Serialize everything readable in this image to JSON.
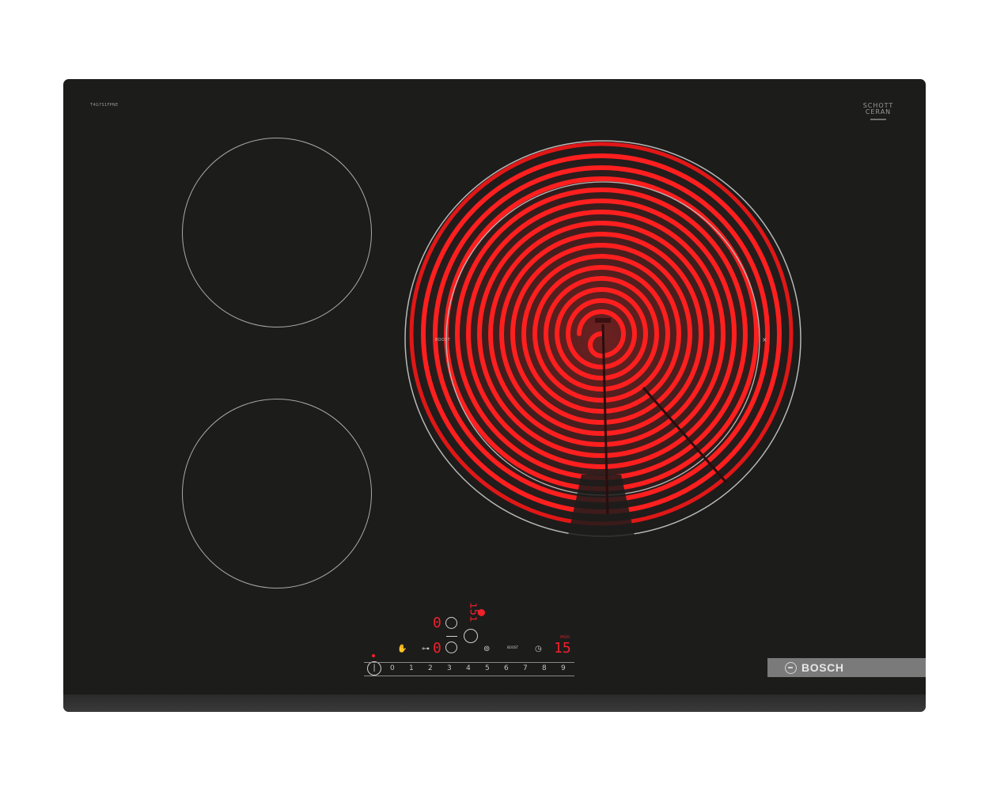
{
  "hob": {
    "model_code": "T4G7S1FPNE",
    "glass_brand_line1": "SCHOTT",
    "glass_brand_line2": "CERAN",
    "brand": "BOSCH",
    "zone_label_boost": "BOOST"
  },
  "controls": {
    "display_left_top": "0",
    "display_left_bottom": "0",
    "display_center_top": "ı5ı",
    "timer_value": "15",
    "timer_unit": "min",
    "boost_label": "BOOST",
    "power_icon": "power-icon",
    "slider_numbers": [
      "0",
      "1",
      "2",
      "3",
      "4",
      "5",
      "6",
      "7",
      "8",
      "9"
    ]
  },
  "colors": {
    "glass": "#1c1c1b",
    "heat_red": "#ff1a1a",
    "display_red": "#f0212b",
    "brand_bar": "#7a7a7a"
  }
}
